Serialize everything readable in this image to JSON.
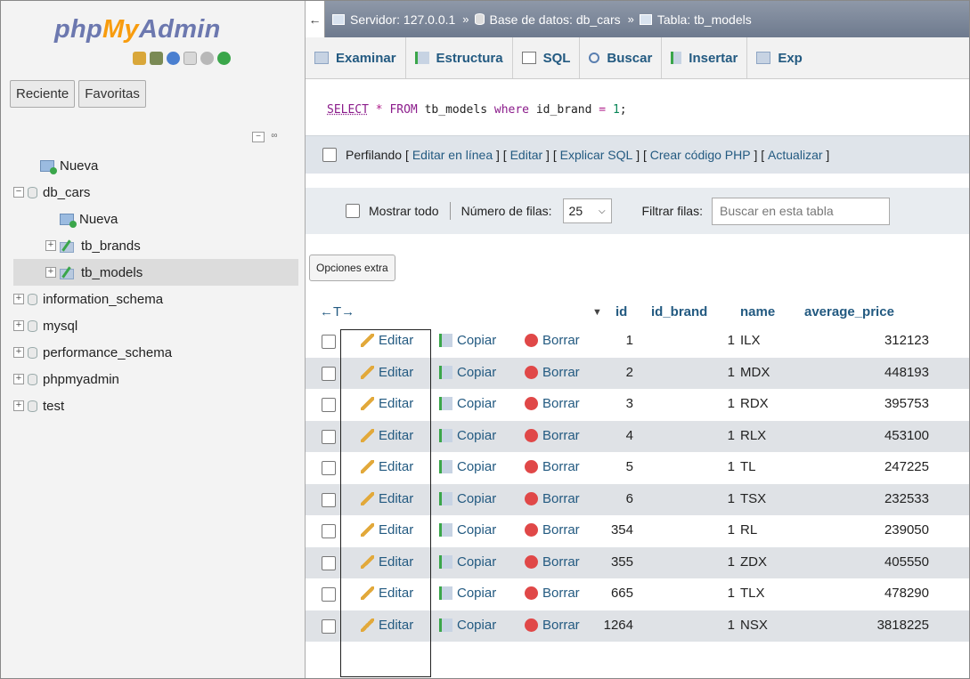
{
  "nav": {
    "logo": {
      "php": "php",
      "my": "My",
      "admin": "Admin"
    },
    "tabs": [
      "Reciente",
      "Favoritas"
    ],
    "tree": {
      "new_root": "Nueva",
      "db_cars": "db_cars",
      "db_new": "Nueva",
      "tb_brands": "tb_brands",
      "tb_models": "tb_models",
      "information_schema": "information_schema",
      "mysql": "mysql",
      "performance_schema": "performance_schema",
      "phpmyadmin": "phpmyadmin",
      "test": "test"
    },
    "icons": [
      "home-icon",
      "sql-icon",
      "help-icon",
      "docs-icon",
      "settings-icon",
      "reload-icon"
    ]
  },
  "breadcrumb": {
    "server": "Servidor: 127.0.0.1",
    "database": "Base de datos: db_cars",
    "table": "Tabla: tb_models",
    "sep": "»"
  },
  "tabs": [
    "Examinar",
    "Estructura",
    "SQL",
    "Buscar",
    "Insertar",
    "Exp"
  ],
  "sql": {
    "select": "SELECT",
    "star": "*",
    "from": "FROM",
    "table": "tb_models",
    "where": "where",
    "column": "id_brand",
    "eq": "=",
    "value": "1",
    "end": ";"
  },
  "profiling": {
    "label": "Perfilando",
    "links": [
      "Editar en línea",
      "Editar",
      "Explicar SQL",
      "Crear código PHP",
      "Actualizar"
    ]
  },
  "filter": {
    "show_all": "Mostrar todo",
    "rows_label": "Número de filas:",
    "rows_value": "25",
    "filter_label": "Filtrar filas:",
    "search_placeholder": "Buscar en esta tabla"
  },
  "extra_options": "Opciones extra",
  "grid": {
    "arrows": "←T→",
    "sort_icon": "▼",
    "columns": [
      "id",
      "id_brand",
      "name",
      "average_price"
    ],
    "actions": {
      "edit": "Editar",
      "copy": "Copiar",
      "delete": "Borrar"
    },
    "rows": [
      {
        "id": "1",
        "id_brand": "1",
        "name": "ILX",
        "average_price": "312123"
      },
      {
        "id": "2",
        "id_brand": "1",
        "name": "MDX",
        "average_price": "448193"
      },
      {
        "id": "3",
        "id_brand": "1",
        "name": "RDX",
        "average_price": "395753"
      },
      {
        "id": "4",
        "id_brand": "1",
        "name": "RLX",
        "average_price": "453100"
      },
      {
        "id": "5",
        "id_brand": "1",
        "name": "TL",
        "average_price": "247225"
      },
      {
        "id": "6",
        "id_brand": "1",
        "name": "TSX",
        "average_price": "232533"
      },
      {
        "id": "354",
        "id_brand": "1",
        "name": "RL",
        "average_price": "239050"
      },
      {
        "id": "355",
        "id_brand": "1",
        "name": "ZDX",
        "average_price": "405550"
      },
      {
        "id": "665",
        "id_brand": "1",
        "name": "TLX",
        "average_price": "478290"
      },
      {
        "id": "1264",
        "id_brand": "1",
        "name": "NSX",
        "average_price": "3818225"
      }
    ]
  }
}
